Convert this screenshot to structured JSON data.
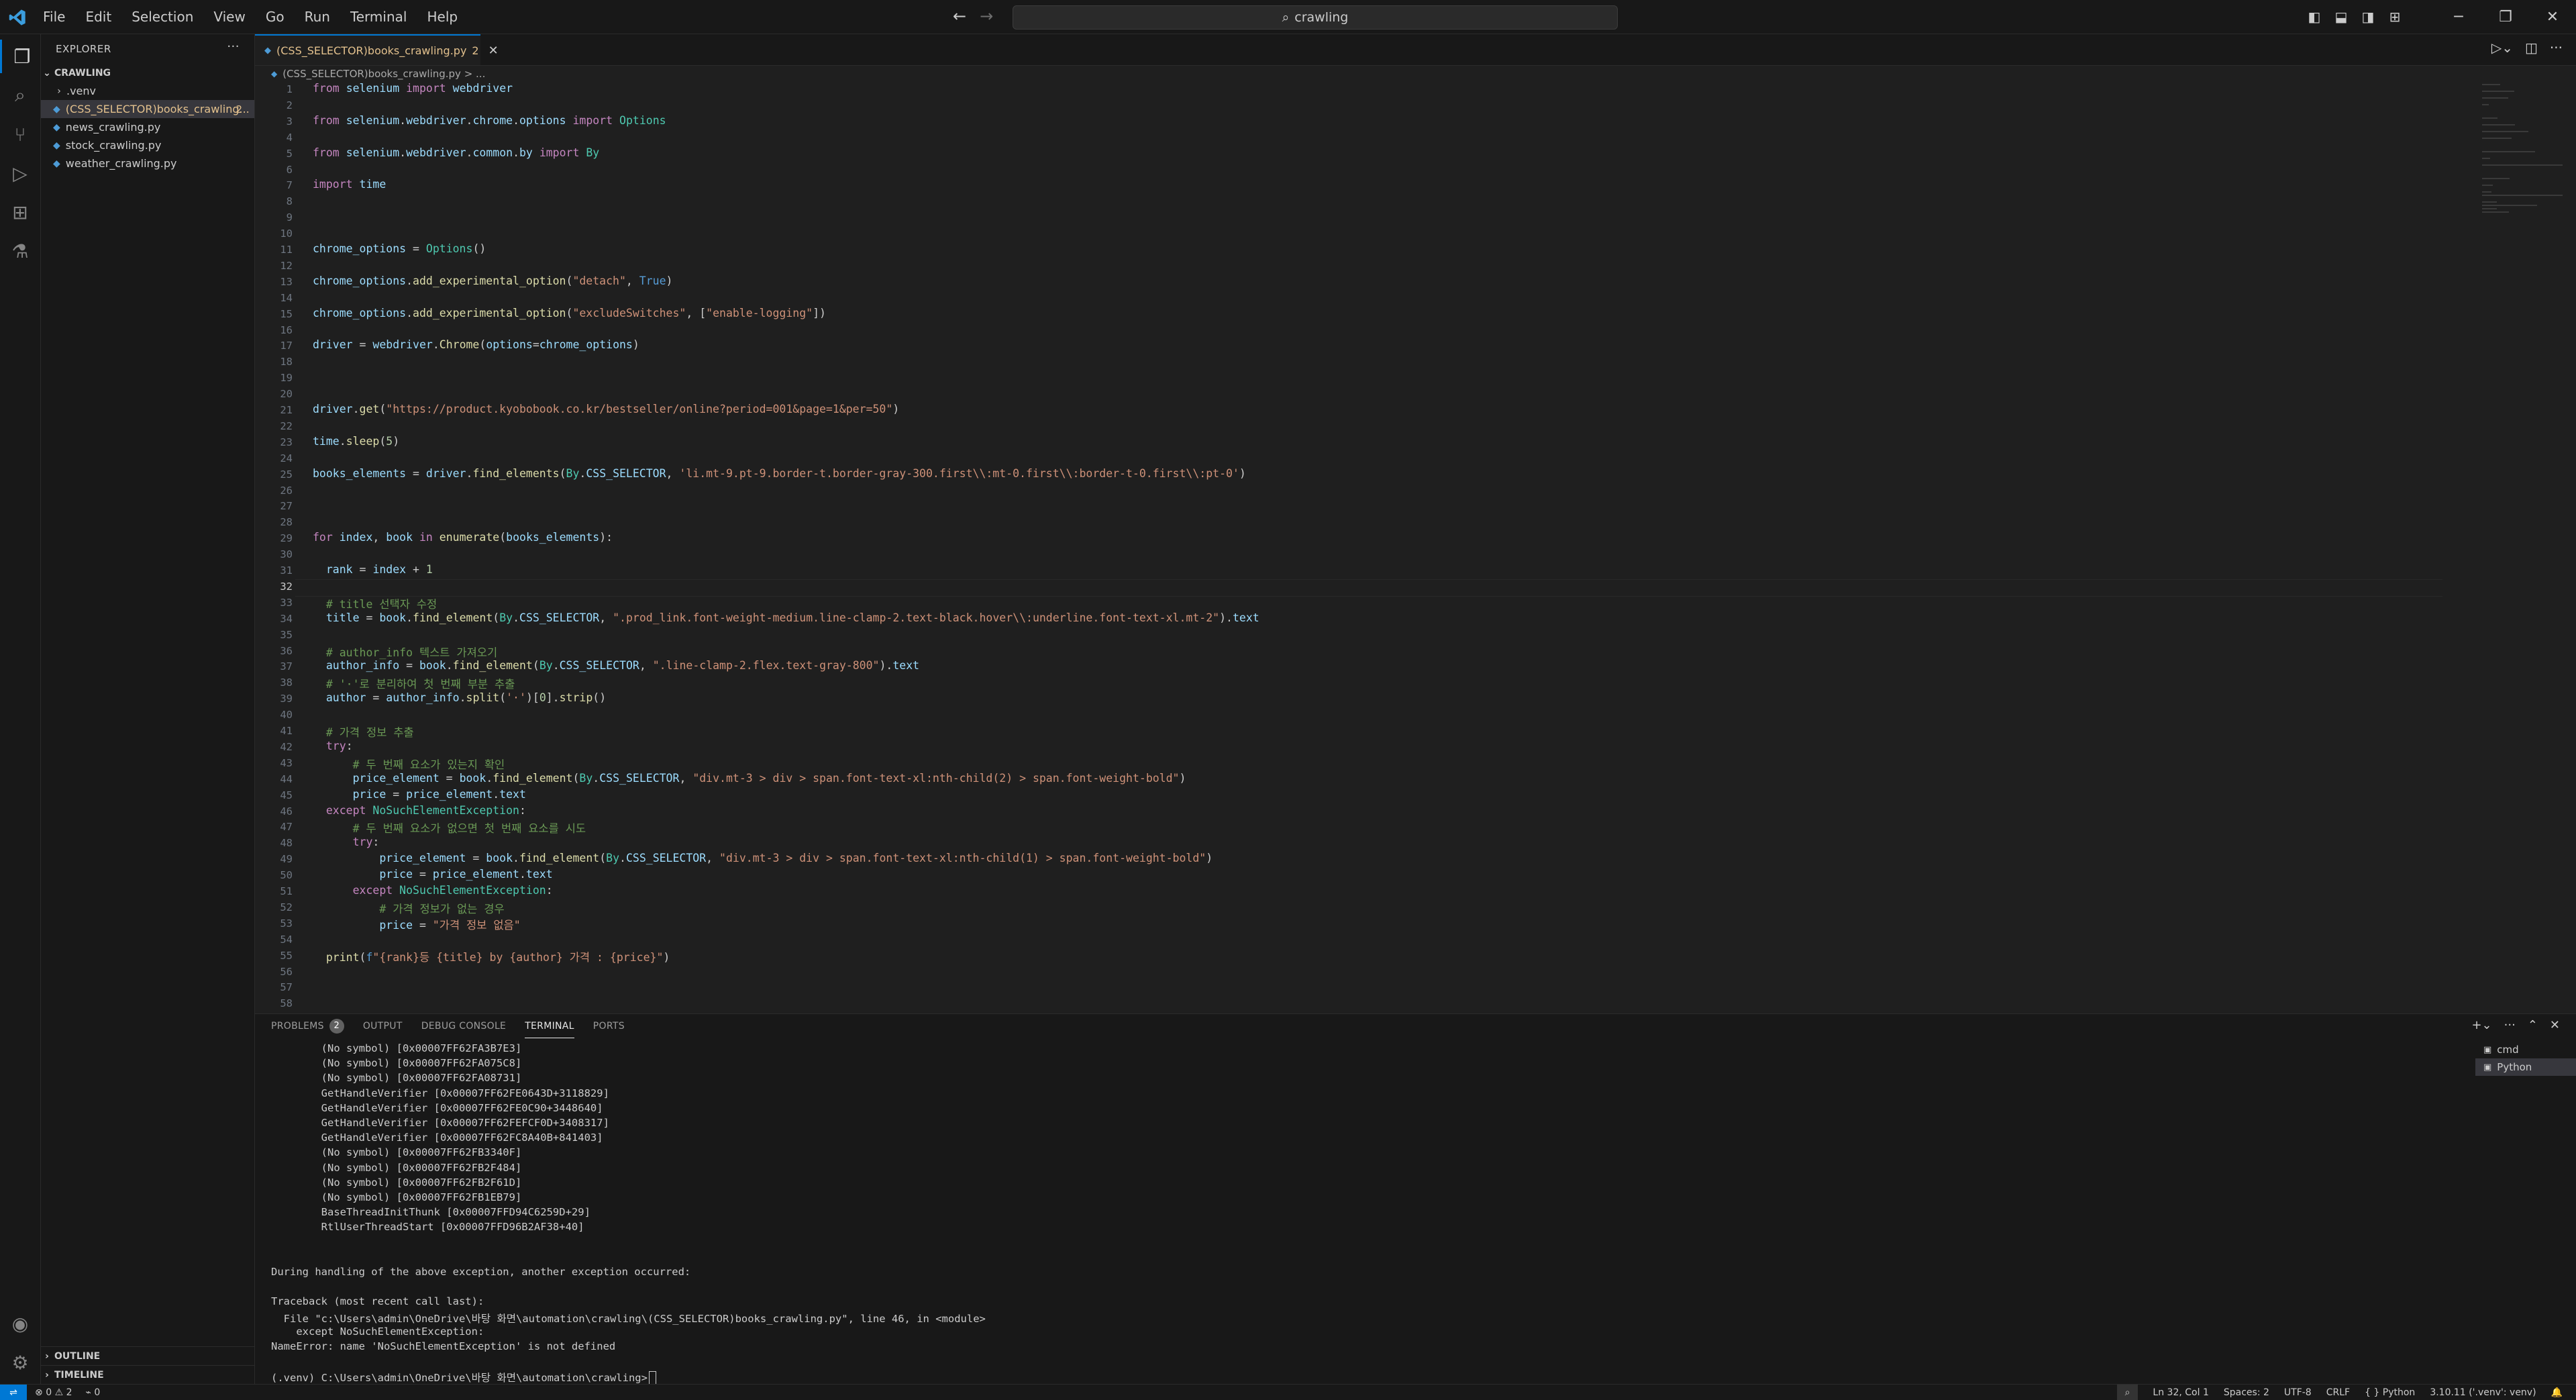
{
  "menu": [
    "File",
    "Edit",
    "Selection",
    "View",
    "Go",
    "Run",
    "Terminal",
    "Help"
  ],
  "search": {
    "text": "crawling"
  },
  "sidebar": {
    "title": "EXPLORER",
    "folder": "CRAWLING",
    "items": [
      {
        "label": ".venv",
        "type": "folder"
      },
      {
        "label": "(CSS_SELECTOR)books_crawling...",
        "type": "py",
        "badge": "2",
        "selected": true
      },
      {
        "label": "news_crawling.py",
        "type": "py"
      },
      {
        "label": "stock_crawling.py",
        "type": "py"
      },
      {
        "label": "weather_crawling.py",
        "type": "py"
      }
    ],
    "outline": "OUTLINE",
    "timeline": "TIMELINE"
  },
  "editor": {
    "tab_label": "(CSS_SELECTOR)books_crawling.py",
    "tab_problems": "2",
    "breadcrumb": "(CSS_SELECTOR)books_crawling.py > ...",
    "current_line": 32
  },
  "code_lines": [
    "from selenium import webdriver",
    "",
    "from selenium.webdriver.chrome.options import Options",
    "",
    "from selenium.webdriver.common.by import By",
    "",
    "import time",
    "",
    "",
    "",
    "chrome_options = Options()",
    "",
    "chrome_options.add_experimental_option(\"detach\", True)",
    "",
    "chrome_options.add_experimental_option(\"excludeSwitches\", [\"enable-logging\"])",
    "",
    "driver = webdriver.Chrome(options=chrome_options)",
    "",
    "",
    "",
    "driver.get(\"https://product.kyobobook.co.kr/bestseller/online?period=001&page=1&per=50\")",
    "",
    "time.sleep(5)",
    "",
    "books_elements = driver.find_elements(By.CSS_SELECTOR, 'li.mt-9.pt-9.border-t.border-gray-300.first\\\\:mt-0.first\\\\:border-t-0.first\\\\:pt-0')",
    "",
    "",
    "",
    "for index, book in enumerate(books_elements):",
    "",
    "  rank = index + 1",
    "",
    "  # title 선택자 수정",
    "  title = book.find_element(By.CSS_SELECTOR, \".prod_link.font-weight-medium.line-clamp-2.text-black.hover\\\\:underline.font-text-xl.mt-2\").text",
    "",
    "  # author_info 텍스트 가져오기",
    "  author_info = book.find_element(By.CSS_SELECTOR, \".line-clamp-2.flex.text-gray-800\").text",
    "  # '·'로 분리하여 첫 번째 부분 추출",
    "  author = author_info.split('·')[0].strip()",
    "",
    "  # 가격 정보 추출",
    "  try:",
    "      # 두 번째 요소가 있는지 확인",
    "      price_element = book.find_element(By.CSS_SELECTOR, \"div.mt-3 > div > span.font-text-xl:nth-child(2) > span.font-weight-bold\")",
    "      price = price_element.text",
    "  except NoSuchElementException:",
    "      # 두 번째 요소가 없으면 첫 번째 요소를 시도",
    "      try:",
    "          price_element = book.find_element(By.CSS_SELECTOR, \"div.mt-3 > div > span.font-text-xl:nth-child(1) > span.font-weight-bold\")",
    "          price = price_element.text",
    "      except NoSuchElementException:",
    "          # 가격 정보가 없는 경우",
    "          price = \"가격 정보 없음\"",
    "",
    "  print(f\"{rank}등 {title} by {author} 가격 : {price}\")",
    "",
    "",
    ""
  ],
  "panel": {
    "tabs": [
      {
        "label": "PROBLEMS",
        "badge": "2"
      },
      {
        "label": "OUTPUT"
      },
      {
        "label": "DEBUG CONSOLE"
      },
      {
        "label": "TERMINAL",
        "active": true
      },
      {
        "label": "PORTS"
      }
    ],
    "terminal_lines": [
      "        (No symbol) [0x00007FF62FA3B7E3]",
      "        (No symbol) [0x00007FF62FA075C8]",
      "        (No symbol) [0x00007FF62FA08731]",
      "        GetHandleVerifier [0x00007FF62FE0643D+3118829]",
      "        GetHandleVerifier [0x00007FF62FE0C90+3448640]",
      "        GetHandleVerifier [0x00007FF62FEFCF0D+3408317]",
      "        GetHandleVerifier [0x00007FF62FC8A40B+841403]",
      "        (No symbol) [0x00007FF62FB3340F]",
      "        (No symbol) [0x00007FF62FB2F484]",
      "        (No symbol) [0x00007FF62FB2F61D]",
      "        (No symbol) [0x00007FF62FB1EB79]",
      "        BaseThreadInitThunk [0x00007FFD94C6259D+29]",
      "        RtlUserThreadStart [0x00007FFD96B2AF38+40]",
      "",
      "",
      "During handling of the above exception, another exception occurred:",
      "",
      "Traceback (most recent call last):",
      "  File \"c:\\Users\\admin\\OneDrive\\바탕 화면\\automation\\crawling\\(CSS_SELECTOR)books_crawling.py\", line 46, in <module>",
      "    except NoSuchElementException:",
      "NameError: name 'NoSuchElementException' is not defined",
      "",
      "(.venv) C:\\Users\\admin\\OneDrive\\바탕 화면\\automation\\crawling>"
    ],
    "terminals": [
      {
        "label": "cmd"
      },
      {
        "label": "Python",
        "selected": true
      }
    ]
  },
  "status": {
    "errors": "0",
    "warnings": "2",
    "ports": "0",
    "position": "Ln 32, Col 1",
    "spaces": "Spaces: 2",
    "encoding": "UTF-8",
    "eol": "CRLF",
    "language": "Python",
    "interpreter": "3.10.11 ('.venv': venv)"
  },
  "colors": {
    "accent": "#0078d4",
    "modified": "#e2c08d"
  }
}
